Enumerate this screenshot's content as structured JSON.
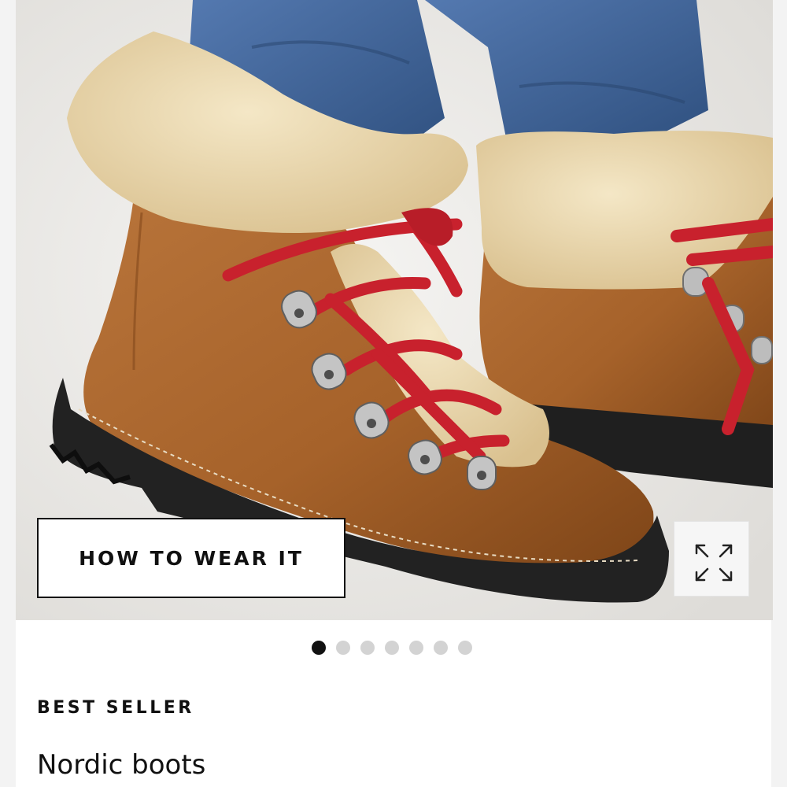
{
  "gallery": {
    "image_alt": "Nordic boots product photo",
    "wear_button_label": "HOW TO WEAR IT",
    "expand_icon": "expand-arrows-icon",
    "slide_count": 7,
    "active_slide": 1
  },
  "product": {
    "badge": "BEST SELLER",
    "title": "Nordic boots"
  },
  "colors": {
    "accent": "#111111",
    "dot_inactive": "#d3d3d3",
    "boot_leather": "#a8652c",
    "laces": "#c8212d",
    "shearling": "#ead7ad",
    "denim": "#3f66a0"
  }
}
